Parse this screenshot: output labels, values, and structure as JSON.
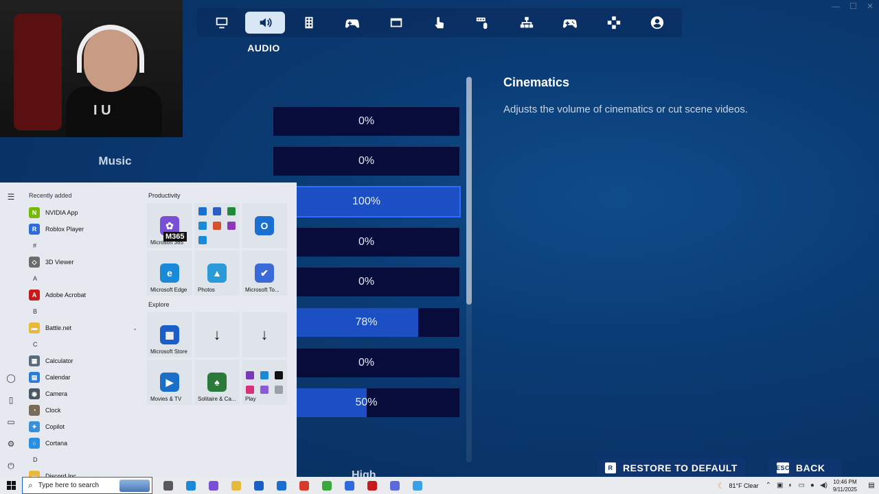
{
  "window": {
    "controls": [
      "—",
      "☐",
      "✕"
    ]
  },
  "nav": {
    "tabs": [
      {
        "icon": "monitor-icon",
        "active": false
      },
      {
        "icon": "speaker-icon",
        "active": true
      },
      {
        "icon": "grid-icon",
        "active": false
      },
      {
        "icon": "controller-settings-icon",
        "active": false
      },
      {
        "icon": "layout-icon",
        "active": false
      },
      {
        "icon": "touch-icon",
        "active": false
      },
      {
        "icon": "keyboard-mouse-icon",
        "active": false
      },
      {
        "icon": "network-icon",
        "active": false
      },
      {
        "icon": "gamepad-icon",
        "active": false
      },
      {
        "icon": "dpad-icon",
        "active": false
      },
      {
        "icon": "account-icon",
        "active": false
      }
    ],
    "active_label": "AUDIO"
  },
  "settings": {
    "row_label": "Music",
    "sliders": [
      {
        "value_text": "0%",
        "fill": 0,
        "selected": false
      },
      {
        "value_text": "0%",
        "fill": 0,
        "selected": false
      },
      {
        "value_text": "100%",
        "fill": 100,
        "selected": true
      },
      {
        "value_text": "0%",
        "fill": 0,
        "selected": false
      },
      {
        "value_text": "0%",
        "fill": 0,
        "selected": false
      },
      {
        "value_text": "78%",
        "fill": 78,
        "selected": false
      },
      {
        "value_text": "0%",
        "fill": 0,
        "selected": false
      },
      {
        "value_text": "50%",
        "fill": 50,
        "selected": false
      }
    ],
    "bottom_label": "High"
  },
  "description": {
    "title": "Cinematics",
    "text": "Adjusts the volume of cinematics or cut scene videos."
  },
  "buttons": {
    "restore": {
      "key": "R",
      "label": "RESTORE TO DEFAULT"
    },
    "back": {
      "key": "ESC",
      "label": "BACK"
    }
  },
  "webcam": {
    "shirt_text": "I U"
  },
  "start_menu": {
    "recently_added_label": "Recently added",
    "apps": [
      {
        "type": "item",
        "label": "NVIDIA App",
        "color": "#76b900",
        "glyph": "N"
      },
      {
        "type": "item",
        "label": "Roblox Player",
        "color": "#2f6be0",
        "glyph": "R"
      },
      {
        "type": "letter",
        "label": "#"
      },
      {
        "type": "item",
        "label": "3D Viewer",
        "color": "#6b6b6b",
        "glyph": "◇"
      },
      {
        "type": "letter",
        "label": "A"
      },
      {
        "type": "item",
        "label": "Adobe Acrobat",
        "color": "#c91a1a",
        "glyph": "A"
      },
      {
        "type": "letter",
        "label": "B"
      },
      {
        "type": "item",
        "label": "Battle.net",
        "color": "#e8b93a",
        "glyph": "▬",
        "chevron": "⌄"
      },
      {
        "type": "letter",
        "label": "C"
      },
      {
        "type": "item",
        "label": "Calculator",
        "color": "#5b6b7c",
        "glyph": "▦"
      },
      {
        "type": "item",
        "label": "Calendar",
        "color": "#2a7ad6",
        "glyph": "▤"
      },
      {
        "type": "item",
        "label": "Camera",
        "color": "#4a5866",
        "glyph": "◉"
      },
      {
        "type": "item",
        "label": "Clock",
        "color": "#7a6a5a",
        "glyph": "◔"
      },
      {
        "type": "item",
        "label": "Copilot",
        "color": "#3a8fd8",
        "glyph": "✦"
      },
      {
        "type": "item",
        "label": "Cortana",
        "color": "#2a8fe0",
        "glyph": "○"
      },
      {
        "type": "letter",
        "label": "D"
      },
      {
        "type": "item",
        "label": "Discord Inc",
        "color": "#e8b93a",
        "glyph": "▬",
        "chevron": "⌄"
      }
    ],
    "groups": [
      {
        "title": "Productivity",
        "tiles": [
          {
            "label": "Microsoft 365",
            "color": "#7a4fd8",
            "glyph": "✿",
            "badge": "M365"
          },
          {
            "label": "",
            "mini": [
              "#1a6fd0",
              "#2b5fc8",
              "#1f8a3a",
              "#1a8ad8",
              "#d8502a",
              "#8a3ab8",
              "#1a8ad8"
            ]
          },
          {
            "label": "",
            "color": "#1a6fd0",
            "glyph": "O"
          },
          {
            "label": "Microsoft Edge",
            "color": "#1a8ad8",
            "glyph": "e"
          },
          {
            "label": "Photos",
            "color": "#2a9ad8",
            "glyph": "▲"
          },
          {
            "label": "Microsoft To...",
            "color": "#3a6ad8",
            "glyph": "✔"
          }
        ]
      },
      {
        "title": "Explore",
        "tiles": [
          {
            "label": "Microsoft Store",
            "color": "#1a5fc8",
            "glyph": "▦"
          },
          {
            "label": "",
            "glyph": "↓",
            "plain": true
          },
          {
            "label": "",
            "glyph": "↓",
            "plain": true
          },
          {
            "label": "Movies & TV",
            "color": "#1a6fc8",
            "glyph": "▶"
          },
          {
            "label": "Solitaire & Ca...",
            "color": "#2a7a3a",
            "glyph": "♠"
          },
          {
            "label": "Play",
            "mini": [
              "#7a3ab8",
              "#1a8ad8",
              "#111111",
              "#d8307a",
              "#8a5ad8",
              "#9aa0a8"
            ]
          }
        ]
      }
    ]
  },
  "taskbar": {
    "search_placeholder": "Type here to search",
    "weather": "81°F  Clear",
    "time": "10:46 PM",
    "date": "9/11/2025",
    "pinned": [
      "#5a5a5a",
      "#1a8ad8",
      "#7a4fd8",
      "#e8b93a",
      "#1a5fc8",
      "#1a6fd0",
      "#d83a2a",
      "#3aa83a",
      "#2f6be0",
      "#c81a1a",
      "#5a6ad8",
      "#3aa0e8"
    ]
  }
}
